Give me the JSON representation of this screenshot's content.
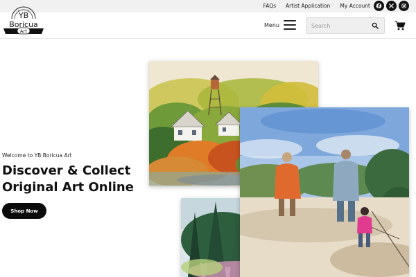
{
  "topbar": {
    "links": [
      "FAQs",
      "Artist Application",
      "My Account"
    ],
    "social_icons": [
      "facebook-icon",
      "x-icon",
      "instagram-icon"
    ]
  },
  "header": {
    "logo_top": "YB",
    "logo_bottom": "Boricua",
    "logo_tag": "Art",
    "menu_label": "Menu",
    "search_placeholder": "Search"
  },
  "hero": {
    "welcome": "Welcome to YB Boricua Art",
    "headline_line1": "Discover & Collect",
    "headline_line2": "Original Art Online",
    "cta_label": "Shop Now"
  },
  "colors": {
    "accent": "#0b0b0b",
    "topbar_bg": "#f1f1f1"
  }
}
